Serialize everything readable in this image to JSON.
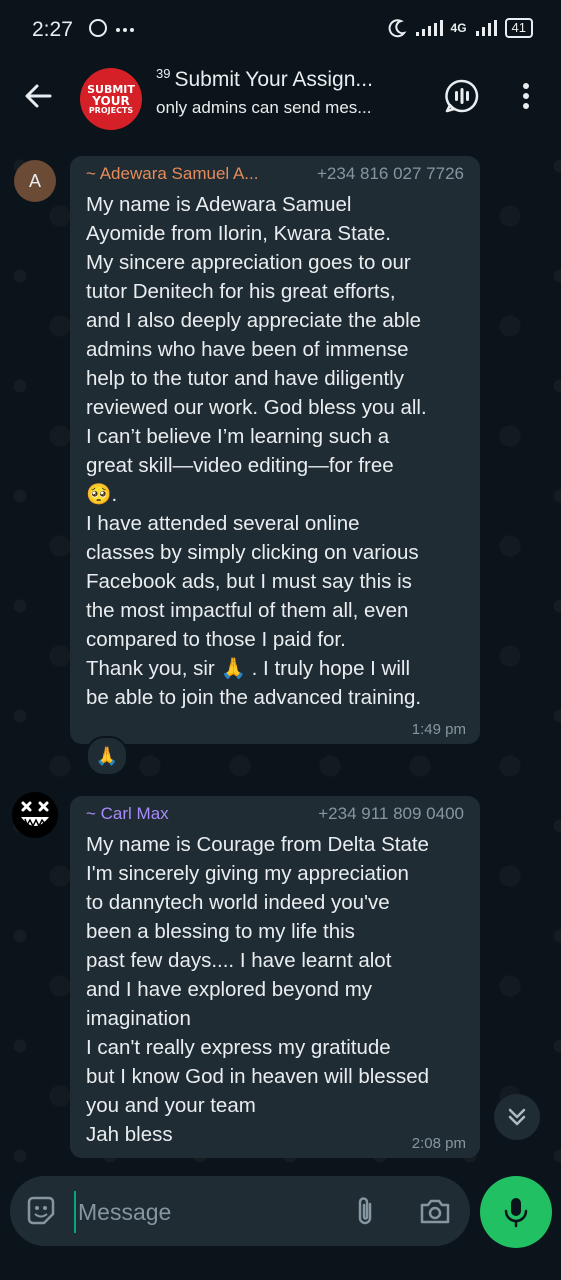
{
  "status_bar": {
    "time": "2:27",
    "left_icons": "✓ ···",
    "network": "4G",
    "battery": "41"
  },
  "header": {
    "group_avatar_text": [
      "SUBMIT",
      "YOUR",
      "PROJECTS"
    ],
    "member_count": "39",
    "title": "Submit Your Assign...",
    "subtitle": "only admins can send mes..."
  },
  "messages": [
    {
      "avatar_letter": "A",
      "sender": "~ Adewara Samuel A...",
      "phone": "+234 816 027 7726",
      "text": "My name is Adewara Samuel\nAyomide from Ilorin, Kwara State.\nMy sincere appreciation goes to our\ntutor Denitech for his great efforts,\nand I also deeply appreciate the able\nadmins who have been of immense\nhelp to the tutor and have diligently\nreviewed our work. God bless you all.\nI can’t believe I’m learning such a\ngreat skill—video editing—for free\n🥺.\nI have attended several online\nclasses by simply clicking on various\nFacebook ads, but I must say this is\nthe most impactful of them all, even\ncompared to those I paid for.\nThank you, sir 🙏 . I truly hope I will\nbe able to join the advanced training.",
      "time": "1:49 pm",
      "reaction": "🙏"
    },
    {
      "sender": "~ Carl Max",
      "phone": "+234 911 809 0400",
      "text": "My name is Courage from Delta State\nI'm sincerely giving my appreciation\nto dannytech world indeed you've\nbeen a blessing to my life this\npast few days.... I  have learnt alot\nand I have explored beyond my\nimagination\nI can't really express my gratitude\nbut I know God in heaven will blessed\nyou and your team\nJah bless",
      "time": "2:08 pm"
    }
  ],
  "input": {
    "placeholder": "Message"
  },
  "colors": {
    "accent": "#21c063",
    "bubble": "#202c33",
    "background": "#0b141a",
    "sender1": "#e58b5b",
    "sender2": "#a78bfa"
  }
}
